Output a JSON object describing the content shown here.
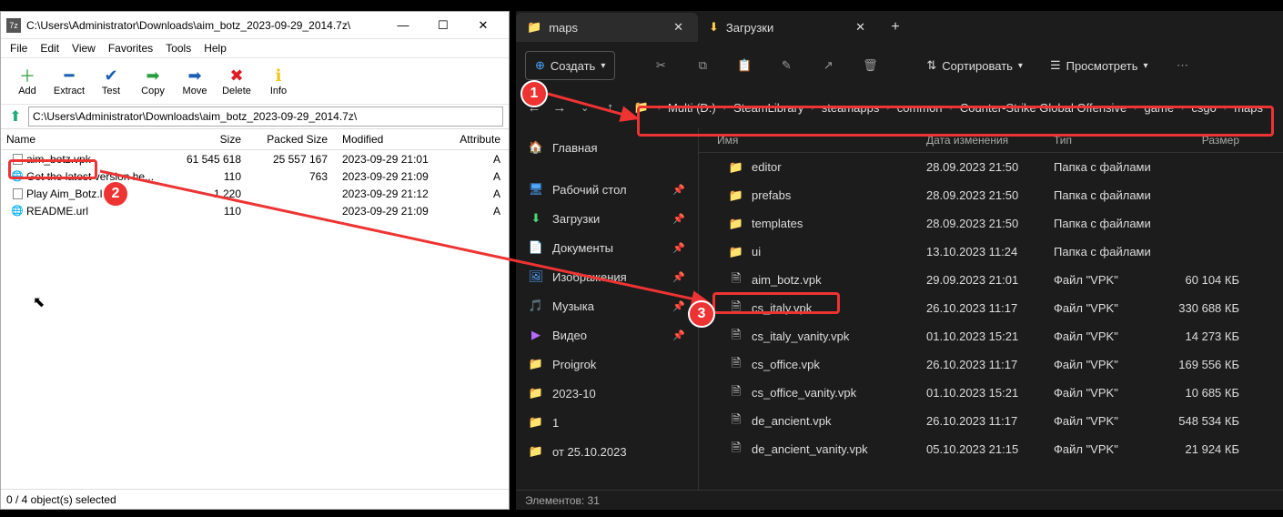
{
  "sevenzip": {
    "title": "C:\\Users\\Administrator\\Downloads\\aim_botz_2023-09-29_2014.7z\\",
    "title_icon": "7z",
    "menu": [
      "File",
      "Edit",
      "View",
      "Favorites",
      "Tools",
      "Help"
    ],
    "tools": [
      {
        "label": "Add",
        "icon": "＋",
        "color": "#2a9d3f"
      },
      {
        "label": "Extract",
        "icon": "━",
        "color": "#1a5fb4"
      },
      {
        "label": "Test",
        "icon": "✔",
        "color": "#1a5fb4"
      },
      {
        "label": "Copy",
        "icon": "➡",
        "color": "#2a9d3f"
      },
      {
        "label": "Move",
        "icon": "➡",
        "color": "#1a5fb4"
      },
      {
        "label": "Delete",
        "icon": "✖",
        "color": "#e01b24"
      },
      {
        "label": "Info",
        "icon": "ℹ",
        "color": "#f5c211"
      }
    ],
    "address": "C:\\Users\\Administrator\\Downloads\\aim_botz_2023-09-29_2014.7z\\",
    "columns": {
      "name": "Name",
      "size": "Size",
      "psize": "Packed Size",
      "modified": "Modified",
      "attr": "Attribute"
    },
    "files": [
      {
        "name": "aim_botz.vpk",
        "size": "61 545 618",
        "psize": "25 557 167",
        "modified": "2023-09-29 21:01",
        "attr": "A",
        "icon": "doc"
      },
      {
        "name": "Get the latest version he...",
        "size": "110",
        "psize": "763",
        "modified": "2023-09-29 21:09",
        "attr": "A",
        "icon": "url"
      },
      {
        "name": "Play Aim_Botz.l",
        "size": "1 220",
        "psize": "",
        "modified": "2023-09-29 21:12",
        "attr": "A",
        "icon": "doc"
      },
      {
        "name": "README.url",
        "size": "110",
        "psize": "",
        "modified": "2023-09-29 21:09",
        "attr": "A",
        "icon": "url"
      }
    ],
    "status": "0 / 4 object(s) selected"
  },
  "explorer": {
    "tabs": [
      {
        "label": "maps",
        "icon": "folder",
        "active": true
      },
      {
        "label": "Загрузки",
        "icon": "download",
        "active": false
      }
    ],
    "toolbar": {
      "create": "Создать",
      "sort": "Сортировать",
      "view": "Просмотреть"
    },
    "breadcrumb": [
      "Multi (D:)",
      "SteamLibrary",
      "steamapps",
      "common",
      "Counter-Strike Global Offensive",
      "game",
      "csgo",
      "maps"
    ],
    "sidebar": [
      {
        "label": "Главная",
        "icon": "🏠",
        "pin": false
      },
      {
        "label": "Рабочий стол",
        "icon": "🖥",
        "pin": true,
        "color": "#4da6ff"
      },
      {
        "label": "Загрузки",
        "icon": "⬇",
        "pin": true,
        "color": "#4dd67a"
      },
      {
        "label": "Документы",
        "icon": "📄",
        "pin": true,
        "color": "#7aa5ff"
      },
      {
        "label": "Изображения",
        "icon": "🖼",
        "pin": true,
        "color": "#4da6ff"
      },
      {
        "label": "Музыка",
        "icon": "🎵",
        "pin": true,
        "color": "#ff5c8a"
      },
      {
        "label": "Видео",
        "icon": "▶",
        "pin": true,
        "color": "#b36bff"
      },
      {
        "label": "Proigrok",
        "icon": "📁",
        "pin": false,
        "color": "#ffc94a"
      },
      {
        "label": "2023-10",
        "icon": "📁",
        "pin": false,
        "color": "#ffc94a"
      },
      {
        "label": "1",
        "icon": "📁",
        "pin": false,
        "color": "#ffc94a"
      },
      {
        "label": "от 25.10.2023",
        "icon": "📁",
        "pin": false,
        "color": "#ffc94a"
      }
    ],
    "columns": {
      "name": "Имя",
      "date": "Дата изменения",
      "type": "Тип",
      "size": "Размер"
    },
    "files": [
      {
        "name": "editor",
        "date": "28.09.2023 21:50",
        "type": "Папка с файлами",
        "size": "",
        "kind": "folder"
      },
      {
        "name": "prefabs",
        "date": "28.09.2023 21:50",
        "type": "Папка с файлами",
        "size": "",
        "kind": "folder"
      },
      {
        "name": "templates",
        "date": "28.09.2023 21:50",
        "type": "Папка с файлами",
        "size": "",
        "kind": "folder"
      },
      {
        "name": "ui",
        "date": "13.10.2023 11:24",
        "type": "Папка с файлами",
        "size": "",
        "kind": "folder"
      },
      {
        "name": "aim_botz.vpk",
        "date": "29.09.2023 21:01",
        "type": "Файл \"VPK\"",
        "size": "60 104 КБ",
        "kind": "file",
        "highlight": true
      },
      {
        "name": "cs_italy.vpk",
        "date": "26.10.2023 11:17",
        "type": "Файл \"VPK\"",
        "size": "330 688 КБ",
        "kind": "file"
      },
      {
        "name": "cs_italy_vanity.vpk",
        "date": "01.10.2023 15:21",
        "type": "Файл \"VPK\"",
        "size": "14 273 КБ",
        "kind": "file"
      },
      {
        "name": "cs_office.vpk",
        "date": "26.10.2023 11:17",
        "type": "Файл \"VPK\"",
        "size": "169 556 КБ",
        "kind": "file"
      },
      {
        "name": "cs_office_vanity.vpk",
        "date": "01.10.2023 15:21",
        "type": "Файл \"VPK\"",
        "size": "10 685 КБ",
        "kind": "file"
      },
      {
        "name": "de_ancient.vpk",
        "date": "26.10.2023 11:17",
        "type": "Файл \"VPK\"",
        "size": "548 534 КБ",
        "kind": "file"
      },
      {
        "name": "de_ancient_vanity.vpk",
        "date": "05.10.2023 21:15",
        "type": "Файл \"VPK\"",
        "size": "21 924 КБ",
        "kind": "file"
      }
    ],
    "status": "Элементов: 31"
  },
  "annotations": {
    "n1": "1",
    "n2": "2",
    "n3": "3"
  }
}
